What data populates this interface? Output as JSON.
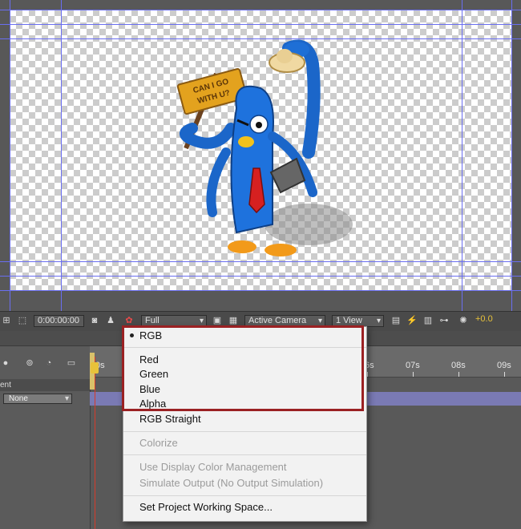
{
  "toolbar": {
    "timecode": "0:00:00:00",
    "resolution": "Full",
    "camera": "Active Camera",
    "view_layout": "1 View",
    "exposure": "+0.0"
  },
  "character": {
    "sign_text_line1": "CAN I GO",
    "sign_text_line2": "WITH U?"
  },
  "timeline": {
    "ticks": [
      "0s",
      "6s",
      "07s",
      "08s",
      "09s"
    ],
    "column_header": "ent",
    "blend_mode": "None",
    "layer_color": "#7a7ab4",
    "playhead_color": "#d63a2a"
  },
  "channel_menu": {
    "selected": "RGB",
    "items": [
      {
        "label": "RGB"
      },
      {
        "label": "Red"
      },
      {
        "label": "Green"
      },
      {
        "label": "Blue"
      },
      {
        "label": "Alpha"
      },
      {
        "label": "RGB Straight"
      },
      {
        "label": "Colorize"
      },
      {
        "label": "Use Display Color Management"
      },
      {
        "label": "Simulate Output (No Output Simulation)"
      },
      {
        "label": "Set Project Working Space..."
      }
    ],
    "highlight_color": "#9b2123"
  }
}
